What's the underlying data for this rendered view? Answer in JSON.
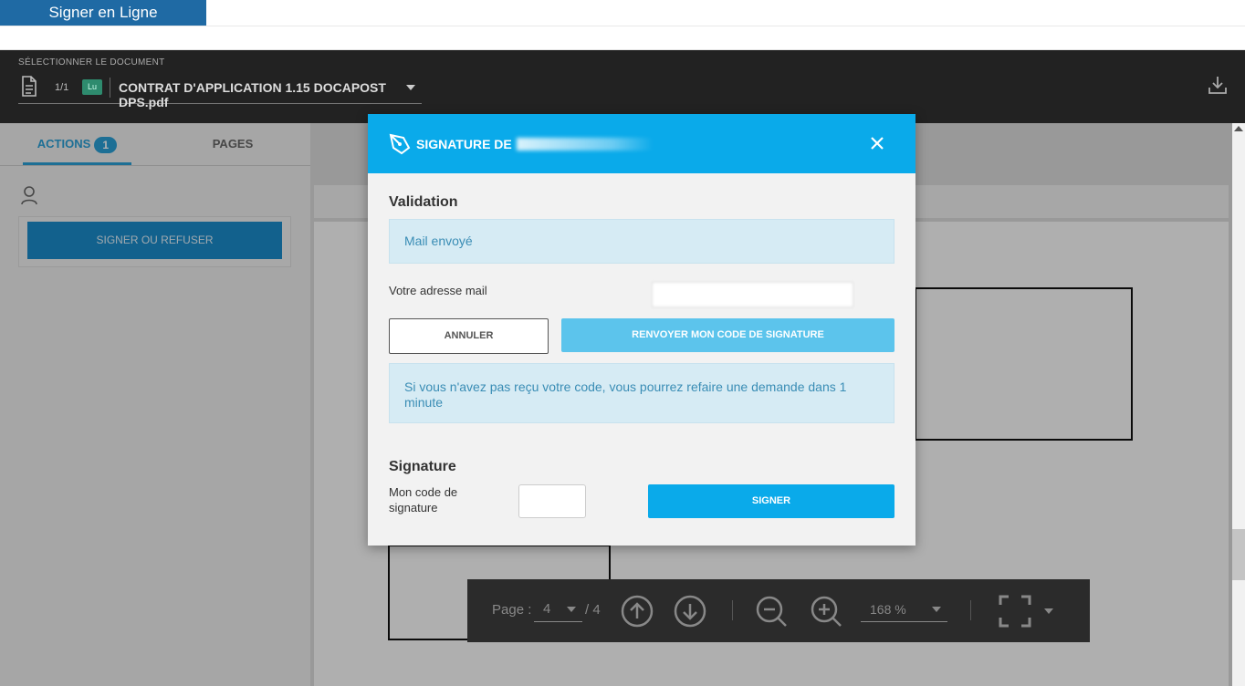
{
  "app": {
    "title": "Signer en Ligne"
  },
  "docbar": {
    "select_label": "SÉLECTIONNER LE DOCUMENT",
    "doc_count": "1/1",
    "doc_badge": "Lu",
    "doc_name": "CONTRAT D'APPLICATION 1.15 DOCAPOST DPS.pdf"
  },
  "sidebar": {
    "tabs": [
      {
        "label": "ACTIONS",
        "badge": "1"
      },
      {
        "label": "PAGES"
      }
    ],
    "signer_name": "",
    "sign_refuse_label": "SIGNER OU REFUSER"
  },
  "toolbar": {
    "page_label": "Page :",
    "page_current": "4",
    "page_total": "/ 4",
    "zoom": "168 %"
  },
  "modal": {
    "title_prefix": "SIGNATURE DE",
    "validation": {
      "title": "Validation",
      "status": "Mail envoyé",
      "email_label": "Votre adresse mail",
      "email_value": "",
      "cancel_label": "ANNULER",
      "resend_label": "RENVOYER MON CODE DE SIGNATURE",
      "info": "Si vous n'avez pas reçu votre code, vous pourrez refaire une demande dans 1 minute"
    },
    "signature": {
      "title": "Signature",
      "code_label": "Mon code de signature",
      "code_value": "",
      "sign_label": "SIGNER"
    }
  },
  "colors": {
    "accent": "#0aaaea",
    "brand": "#1f6aa4",
    "info_bg": "#d6ebf4",
    "info_text": "#3a8db5"
  }
}
